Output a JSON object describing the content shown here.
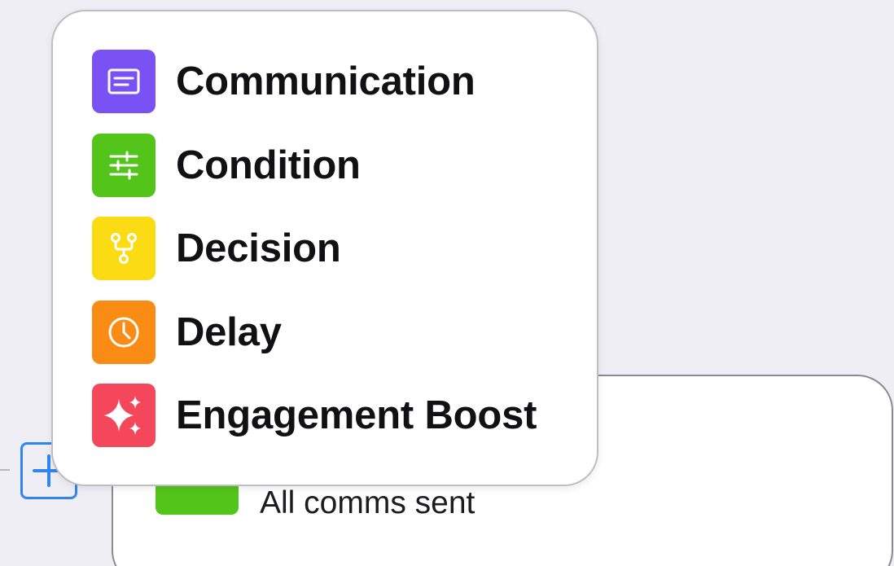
{
  "menu": {
    "items": [
      {
        "label": "Communication",
        "icon": "message-box-icon",
        "color": "#7a52f4"
      },
      {
        "label": "Condition",
        "icon": "sliders-icon",
        "color": "#52c41a"
      },
      {
        "label": "Decision",
        "icon": "branch-icon",
        "color": "#fadb14"
      },
      {
        "label": "Delay",
        "icon": "clock-icon",
        "color": "#fa8c16"
      },
      {
        "label": "Engagement Boost",
        "icon": "sparkle-icon",
        "color": "#f5475c"
      }
    ]
  },
  "node": {
    "subtitle": "All comms sent",
    "swatch_color": "#52c41a"
  },
  "add_button": {
    "icon": "plus-icon",
    "color": "#2f86f0"
  }
}
